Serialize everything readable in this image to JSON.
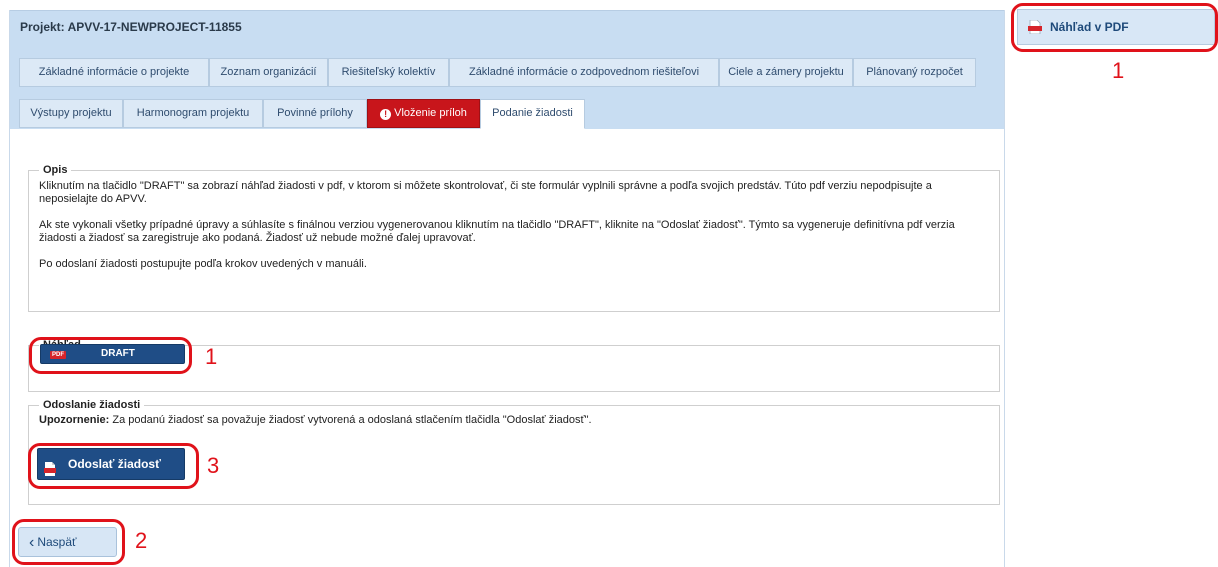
{
  "project": {
    "title": "Projekt: APVV-17-NEWPROJECT-11855"
  },
  "tabs_row1": [
    {
      "label": "Základné informácie o projekte"
    },
    {
      "label": "Zoznam organizácií"
    },
    {
      "label": "Riešiteľský kolektív"
    },
    {
      "label": "Základné informácie o zodpovednom riešiteľovi"
    },
    {
      "label": "Ciele a zámery projektu"
    },
    {
      "label": "Plánovaný rozpočet"
    }
  ],
  "tabs_row2": [
    {
      "label": "Výstupy projektu"
    },
    {
      "label": "Harmonogram projektu"
    },
    {
      "label": "Povinné prílohy"
    },
    {
      "label": "Vloženie príloh",
      "alert_glyph": "!"
    },
    {
      "label": "Podanie žiadosti",
      "active": true
    }
  ],
  "opis": {
    "legend": "Opis",
    "p1": "Kliknutím na tlačidlo \"DRAFT\" sa zobrazí náhľad žiadosti v pdf, v ktorom si môžete skontrolovať, či ste formulár vyplnili správne a podľa svojich predstáv. Túto pdf verziu nepodpisujte a neposielajte do APVV.",
    "p2": "Ak ste vykonali všetky prípadné úpravy a súhlasíte s finálnou verziou vygenerovanou kliknutím na tlačidlo \"DRAFT\", kliknite na \"Odoslať žiadosť\". Týmto sa vygeneruje definitívna pdf verzia žiadosti a žiadosť sa zaregistruje ako podaná. Žiadosť už nebude možné ďalej upravovať.",
    "p3": "Po odoslaní žiadosti postupujte podľa krokov uvedených v manuáli."
  },
  "nahlad": {
    "legend": "Náhľad",
    "button": "DRAFT",
    "badge": "PDF"
  },
  "odoslanie": {
    "legend": "Odoslanie žiadosti",
    "warning_label": "Upozornenie:",
    "warning_text": "Za podanú žiadosť sa považuje žiadosť vytvorená a odoslaná stlačením tlačidla \"Odoslať žiadosť\".",
    "button": "Odoslať žiadosť"
  },
  "back": {
    "label": "Naspäť",
    "chevron": "‹"
  },
  "side": {
    "pdf_button": "Náhľad v PDF"
  },
  "annotations": {
    "n1": "1",
    "n2": "2",
    "n3": "3"
  },
  "colors": {
    "header_band": "#c8ddf2",
    "alert_tab": "#c8151b",
    "dark_button": "#1f4d86",
    "annotation": "#e0121a"
  }
}
